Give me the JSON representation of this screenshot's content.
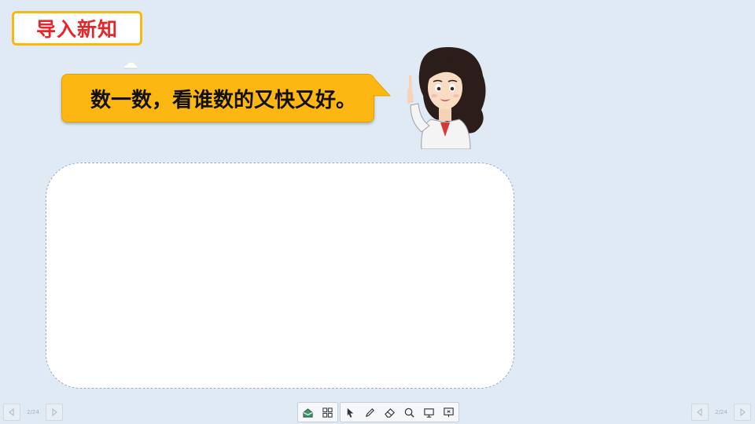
{
  "header": {
    "title": "导入新知"
  },
  "prompt": {
    "text": "数一数，看谁数的又快又好。"
  },
  "nav_left": {
    "page": "2/24"
  },
  "nav_right": {
    "page": "2/24"
  },
  "toolbar": {
    "groups": [
      [
        "home-icon",
        "grid-icon"
      ],
      [
        "pointer-icon",
        "pen-icon",
        "eraser-icon",
        "magnifier-icon",
        "screen-icon",
        "presentation-icon"
      ]
    ]
  },
  "colors": {
    "background": "#dfeaf5",
    "title_text": "#e8262a",
    "title_border": "#f9b80e",
    "bubble": "#fdb713"
  }
}
